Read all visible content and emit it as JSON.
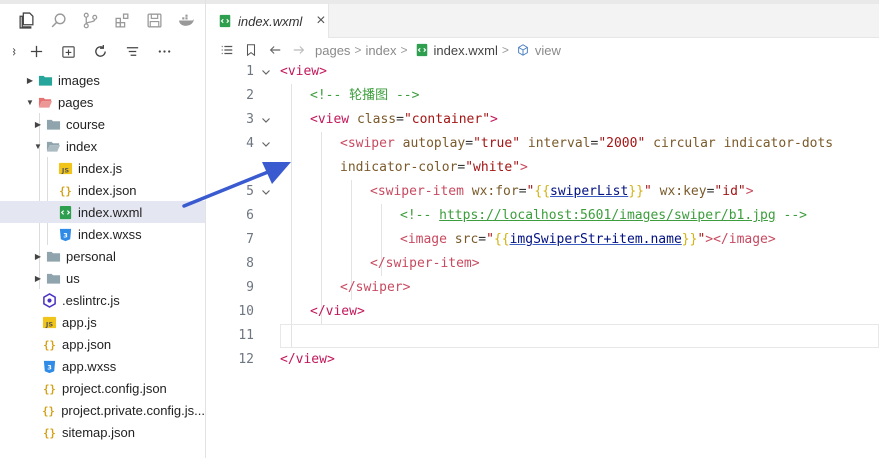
{
  "activity_bar": {
    "icons": [
      "files-icon",
      "search-icon",
      "source-control-icon",
      "extensions-icon",
      "cloud-icon",
      "docker-icon"
    ]
  },
  "explorer_toolbar": {
    "icons": [
      "collapse-icon",
      "new-file-icon",
      "new-folder-icon",
      "refresh-icon",
      "filter-icon",
      "more-icon"
    ]
  },
  "file_tree": [
    {
      "label": "images",
      "type": "folder",
      "open": false,
      "depth": 0,
      "color": "#26a69a"
    },
    {
      "label": "pages",
      "type": "folder",
      "open": true,
      "depth": 0,
      "color": "#e57373"
    },
    {
      "label": "course",
      "type": "folder",
      "open": false,
      "depth": 1,
      "color": "#90a4ae"
    },
    {
      "label": "index",
      "type": "folder",
      "open": true,
      "depth": 1,
      "color": "#90a4ae"
    },
    {
      "label": "index.js",
      "type": "js",
      "depth": 2
    },
    {
      "label": "index.json",
      "type": "json",
      "depth": 2
    },
    {
      "label": "index.wxml",
      "type": "wxml",
      "depth": 2,
      "selected": true
    },
    {
      "label": "index.wxss",
      "type": "wxss",
      "depth": 2
    },
    {
      "label": "personal",
      "type": "folder",
      "open": false,
      "depth": 1,
      "color": "#90a4ae"
    },
    {
      "label": "us",
      "type": "folder",
      "open": false,
      "depth": 1,
      "color": "#90a4ae"
    },
    {
      "label": ".eslintrc.js",
      "type": "eslint",
      "depth": 0
    },
    {
      "label": "app.js",
      "type": "js",
      "depth": 0
    },
    {
      "label": "app.json",
      "type": "json",
      "depth": 0
    },
    {
      "label": "app.wxss",
      "type": "wxss",
      "depth": 0
    },
    {
      "label": "project.config.json",
      "type": "json",
      "depth": 0
    },
    {
      "label": "project.private.config.js...",
      "type": "json",
      "depth": 0
    },
    {
      "label": "sitemap.json",
      "type": "json",
      "depth": 0
    }
  ],
  "editor": {
    "tab": {
      "label": "index.wxml",
      "close": "×"
    },
    "breadcrumb": {
      "items": [
        "pages",
        "index",
        "index.wxml",
        "view"
      ],
      "separator": ">"
    },
    "lines": [
      {
        "n": "1",
        "fold": "open"
      },
      {
        "n": "2"
      },
      {
        "n": "3",
        "fold": "open"
      },
      {
        "n": "4",
        "fold": "open"
      },
      {
        "n": ""
      },
      {
        "n": "5",
        "fold": "open"
      },
      {
        "n": "6"
      },
      {
        "n": "7"
      },
      {
        "n": "8"
      },
      {
        "n": "9"
      },
      {
        "n": "10"
      },
      {
        "n": "11"
      },
      {
        "n": "12"
      }
    ],
    "code": {
      "l1": {
        "open": "<view",
        "close": ">"
      },
      "l2": {
        "comment": "<!-- 轮播图 -->"
      },
      "l3": {
        "tag": "<view",
        "attr": "class",
        "eq": "=",
        "val": "\"container\"",
        "end": ">"
      },
      "l4": {
        "tag": "<swiper",
        "attr1": "autoplay",
        "eq": "=",
        "val1": "\"true\"",
        "attr2": "interval",
        "val2": "\"2000\"",
        "rest": "circular indicator-dots"
      },
      "l4b": {
        "attr": "indicator-color",
        "eq": "=",
        "val": "\"white\"",
        "end": ">"
      },
      "l5": {
        "tag": "<swiper-item",
        "attr1": "wx:for",
        "eq": "=",
        "q": "\"",
        "ob": "{{",
        "var": "swiperList",
        "cb": "}}",
        "attr2": "wx:key",
        "val2": "\"id\"",
        "end": ">"
      },
      "l6": {
        "start": "<!--",
        "url": "https://localhost:5601/images/swiper/b1.jpg",
        "end": "-->"
      },
      "l7": {
        "tag": "<image",
        "attr": "src",
        "eq": "=",
        "q": "\"",
        "ob": "{{",
        "var": "imgSwiperStr+item.name",
        "cb": "}}",
        "end": ">",
        "close": "</image>"
      },
      "l8": {
        "close": "</swiper-item>"
      },
      "l9": {
        "close": "</swiper>"
      },
      "l10": {
        "close": "</view>"
      },
      "l11": {
        "text": ""
      },
      "l12": {
        "close": "</view>"
      }
    }
  },
  "colors": {
    "selection": "#e4e6f1",
    "arrow": "#3a5bd0"
  }
}
